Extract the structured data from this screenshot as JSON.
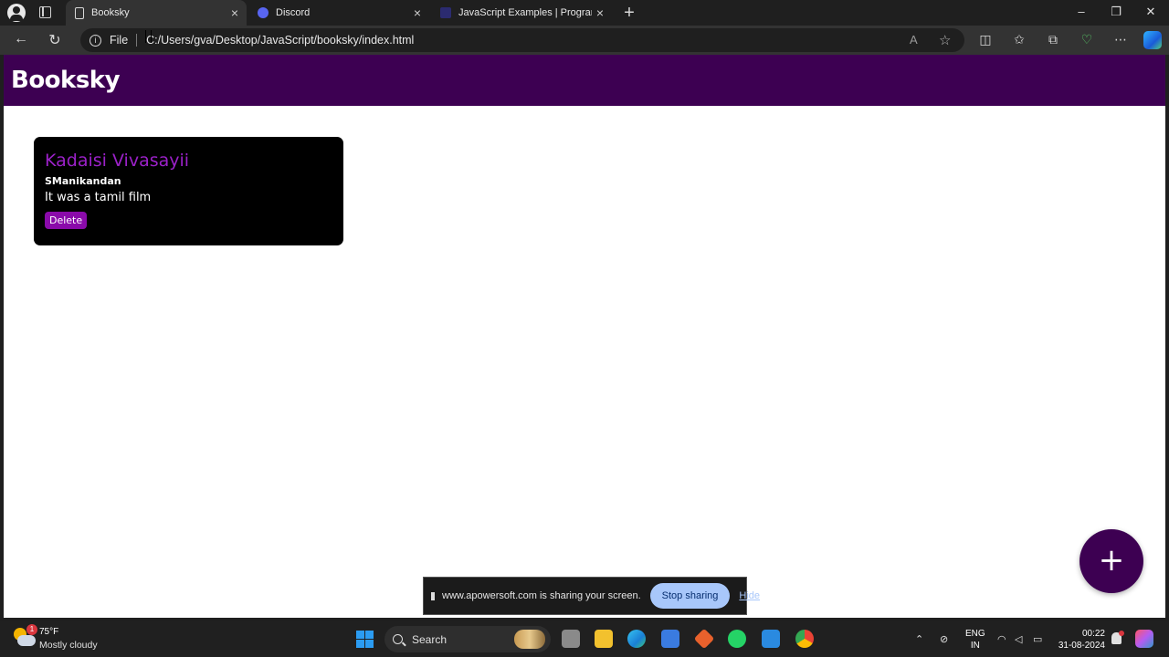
{
  "browser": {
    "tabs": [
      {
        "label": "Booksky",
        "active": true,
        "icon": "document-icon"
      },
      {
        "label": "Discord",
        "active": false,
        "icon": "discord-icon"
      },
      {
        "label": "JavaScript Examples | Programiz",
        "active": false,
        "icon": "programiz-icon"
      }
    ],
    "address": {
      "scheme_label": "File",
      "url": "C:/Users/gva/Desktop/JavaScript/booksky/index.html"
    }
  },
  "page": {
    "site_title": "Booksky",
    "header_color": "#3d0052",
    "books": [
      {
        "title": "Kadaisi Vivasayii",
        "author": "SManikandan",
        "description": "It was a tamil film",
        "delete_label": "Delete"
      }
    ],
    "add_button_label": "+"
  },
  "screen_share": {
    "message": "www.apowersoft.com is sharing your screen.",
    "stop_label": "Stop sharing",
    "hide_label": "Hide"
  },
  "taskbar": {
    "weather": {
      "temperature": "75°F",
      "condition": "Mostly cloudy",
      "badge": "1"
    },
    "search_label": "Search",
    "language": {
      "line1": "ENG",
      "line2": "IN"
    },
    "clock": {
      "time": "00:22",
      "date": "31-08-2024"
    }
  }
}
